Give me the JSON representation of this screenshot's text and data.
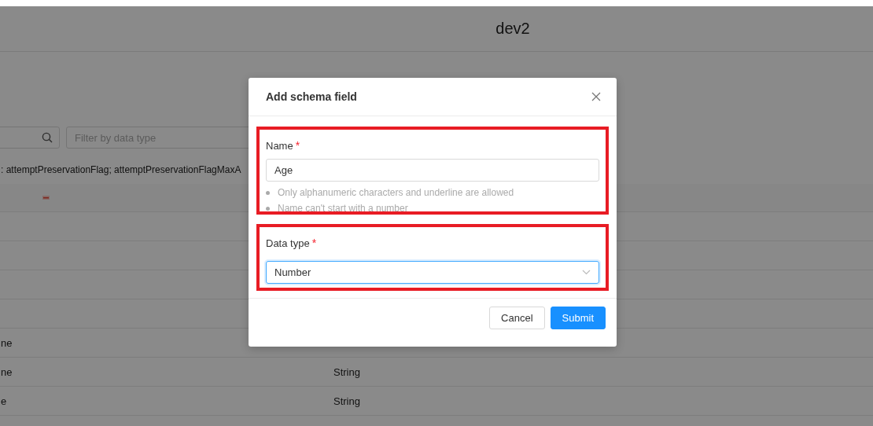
{
  "page": {
    "title": "dev2",
    "type_filter": {
      "placeholder": "Filter by data type"
    },
    "field_list_text": ": attemptPreservationFlag; attemptPreservationFlagMaxA",
    "table": {
      "rows": [
        {
          "column_1": "ne"
        },
        {
          "column_1": "ne",
          "column_2": "String"
        },
        {
          "column_1": "e",
          "column_2": "String"
        }
      ]
    }
  },
  "dialog": {
    "title": "Add schema field",
    "fields": [
      {
        "kind": "text",
        "label": "Name",
        "required_mark": "*",
        "value": "Age",
        "hints": [
          "Only alphanumeric characters and underline are allowed",
          "Name can't start with a number"
        ],
        "highlighted": true
      },
      {
        "kind": "select",
        "label": "Data type",
        "required_mark": "*",
        "value": "Number",
        "focused": true,
        "highlighted": true
      }
    ],
    "buttons": [
      {
        "label": "Cancel",
        "kind": "default"
      },
      {
        "label": "Submit",
        "kind": "primary"
      }
    ]
  }
}
